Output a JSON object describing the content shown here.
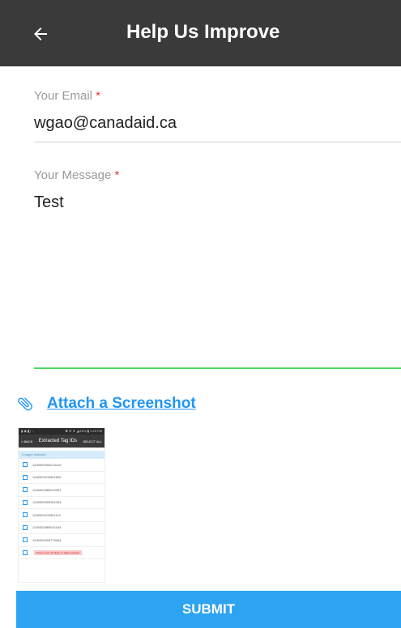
{
  "app_bar": {
    "title": "Help Us Improve",
    "back_icon": "arrow-left-icon",
    "background": "#3a3a3a"
  },
  "form": {
    "email": {
      "label": "Your Email",
      "required_mark": "*",
      "value": "wgao@canadaid.ca"
    },
    "message": {
      "label": "Your Message",
      "required_mark": "*",
      "value": "Test"
    },
    "attach": {
      "label": "Attach a Screenshot",
      "icon": "paperclip-icon"
    },
    "submit_label": "SUBMIT"
  },
  "screenshot_preview": {
    "status_left": "▮ ◉ ◧ ...",
    "status_right": "✱ ✆ ▼ ◢ 29% ▮ 1:29 PM",
    "header_back": "< BACK",
    "header_title": "Extracted Tag IDs",
    "header_action": "SELECT ALL",
    "banner": "0 tag(s) selected",
    "rows": [
      {
        "id": "1240000000014418"
      },
      {
        "id": "1240001100001630"
      },
      {
        "id": "1240003460012301"
      },
      {
        "id": "1240002993301394"
      },
      {
        "id": "1240001100001113"
      },
      {
        "id": "1240003460011044"
      },
      {
        "id": "1240002993770004"
      },
      {
        "id": ""
      }
    ],
    "warning": "Please enter 15 digits / 4 digits selected"
  },
  "colors": {
    "accent": "#2196f3",
    "submit": "#2ea3f2",
    "focus_line": "#4cd964",
    "required": "#e53935"
  }
}
